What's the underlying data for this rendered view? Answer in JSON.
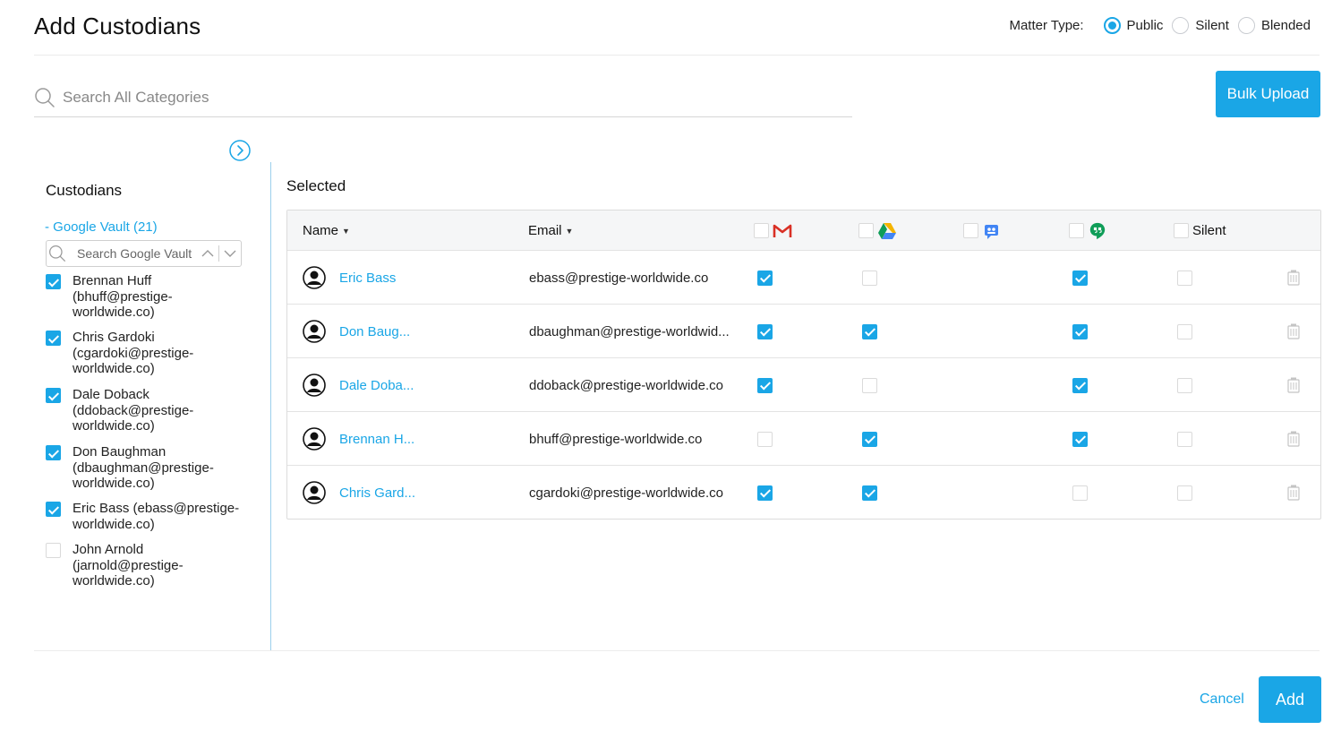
{
  "header": {
    "title": "Add Custodians",
    "matter_type_label": "Matter Type:",
    "matter_types": [
      {
        "label": "Public",
        "selected": true
      },
      {
        "label": "Silent",
        "selected": false
      },
      {
        "label": "Blended",
        "selected": false
      }
    ]
  },
  "search": {
    "placeholder": "Search All Categories",
    "value": ""
  },
  "bulk_upload_label": "Bulk Upload",
  "sidebar": {
    "title": "Custodians",
    "group_label": "- Google Vault (21)",
    "search_placeholder": "Search Google Vault",
    "items": [
      {
        "label": "Brennan Huff (bhuff@prestige-worldwide.co)",
        "checked": true
      },
      {
        "label": "Chris Gardoki (cgardoki@prestige-worldwide.co)",
        "checked": true
      },
      {
        "label": "Dale Doback (ddoback@prestige-worldwide.co)",
        "checked": true
      },
      {
        "label": "Don Baughman (dbaughman@prestige-worldwide.co)",
        "checked": true
      },
      {
        "label": "Eric Bass (ebass@prestige-worldwide.co)",
        "checked": true
      },
      {
        "label": "John Arnold (jarnold@prestige-worldwide.co)",
        "checked": false
      }
    ]
  },
  "selected": {
    "title": "Selected",
    "columns": {
      "name": "Name",
      "email": "Email",
      "gmail_icon": "gmail-icon",
      "drive_icon": "google-drive-icon",
      "groups_icon": "google-groups-icon",
      "hangouts_icon": "hangouts-icon",
      "silent": "Silent"
    },
    "rows": [
      {
        "name": "Eric Bass",
        "email": "ebass@prestige-worldwide.co",
        "gmail": true,
        "drive": false,
        "groups": null,
        "hangouts": true,
        "silent": false
      },
      {
        "name": "Don Baug...",
        "email": "dbaughman@prestige-worldwid...",
        "gmail": true,
        "drive": true,
        "groups": null,
        "hangouts": true,
        "silent": false
      },
      {
        "name": "Dale Doba...",
        "email": "ddoback@prestige-worldwide.co",
        "gmail": true,
        "drive": false,
        "groups": null,
        "hangouts": true,
        "silent": false
      },
      {
        "name": "Brennan H...",
        "email": "bhuff@prestige-worldwide.co",
        "gmail": false,
        "drive": true,
        "groups": null,
        "hangouts": true,
        "silent": false
      },
      {
        "name": "Chris Gard...",
        "email": "cgardoki@prestige-worldwide.co",
        "gmail": true,
        "drive": true,
        "groups": null,
        "hangouts": false,
        "silent": false
      }
    ]
  },
  "footer": {
    "cancel_label": "Cancel",
    "add_label": "Add"
  },
  "colors": {
    "accent": "#1aa6e6",
    "gmail_red": "#d93025",
    "drive_green": "#0f9d58",
    "drive_yellow": "#f4b400",
    "drive_blue": "#4285f4",
    "hangouts_green": "#0f9d58"
  }
}
